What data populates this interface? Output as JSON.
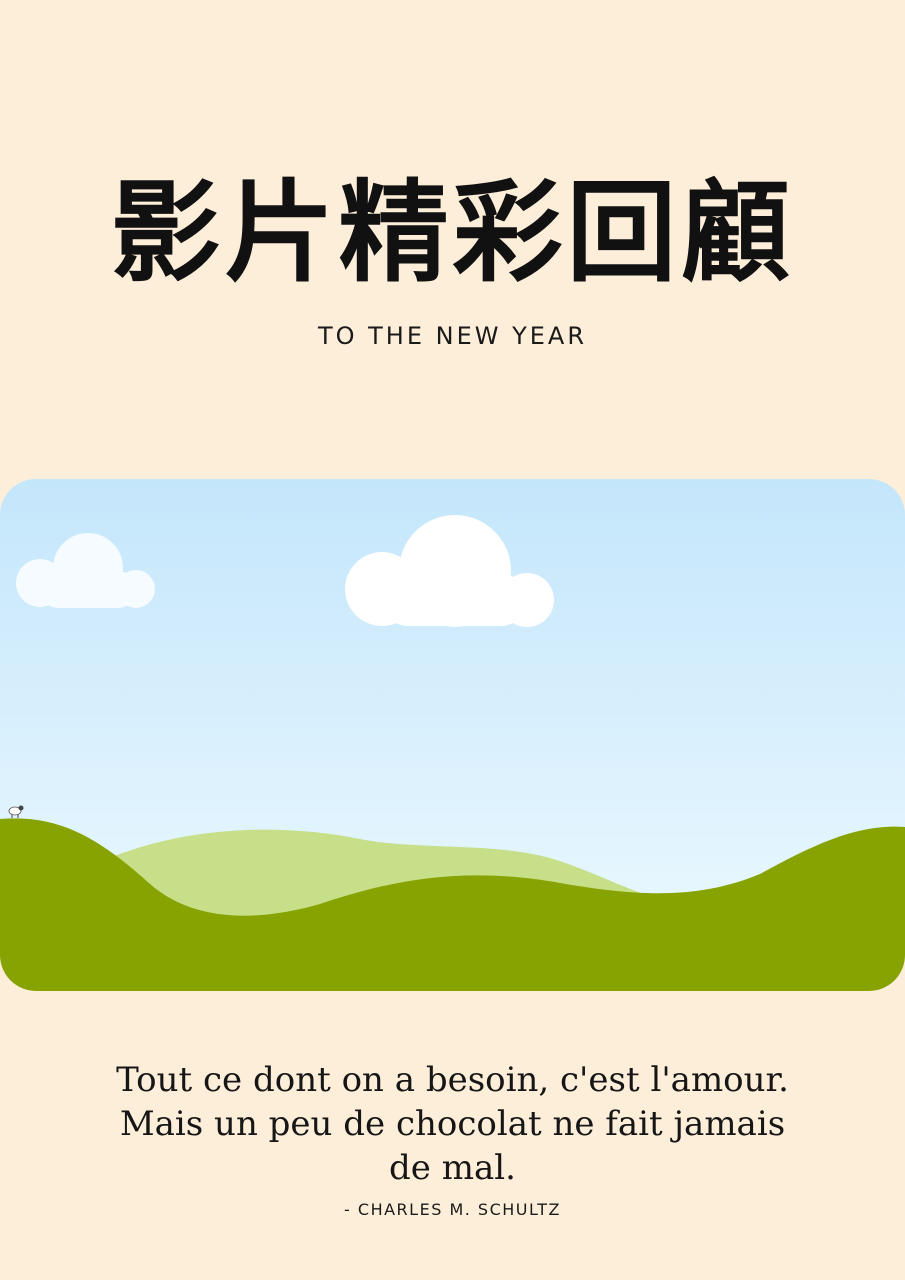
{
  "poster": {
    "title": "影片精彩回顧",
    "subtitle": "TO THE NEW YEAR",
    "quote": "Tout ce dont on a besoin, c'est l'amour. Mais un peu de chocolat ne fait jamais de mal.",
    "author": "- CHARLES M. SCHULTZ"
  },
  "colors": {
    "background": "#fdeed9",
    "sky_top": "#c4e6fb",
    "sky_bottom": "#ebf8fd",
    "hill_dark": "#87a302",
    "hill_light": "#c6df88",
    "cloud": "#ffffff",
    "text": "#111111"
  }
}
